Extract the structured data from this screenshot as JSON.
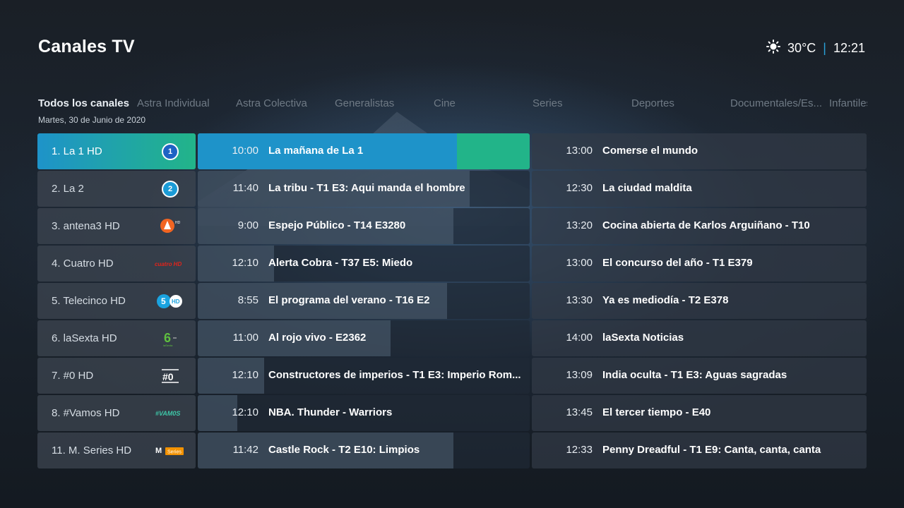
{
  "header": {
    "title": "Canales TV",
    "temperature": "30°C",
    "separator": "|",
    "clock": "12:21",
    "weather_icon": "sun-icon"
  },
  "tabs": [
    {
      "label": "Todos los canales",
      "active": true
    },
    {
      "label": "Astra Individual"
    },
    {
      "label": "Astra Colectiva"
    },
    {
      "label": "Generalistas"
    },
    {
      "label": "Cine"
    },
    {
      "label": "Series"
    },
    {
      "label": "Deportes"
    },
    {
      "label": "Documentales/Es..."
    },
    {
      "label": "Infantiles"
    }
  ],
  "date": "Martes, 30 de Junio de 2020",
  "channels": [
    {
      "name": "1. La 1 HD",
      "logo": "1",
      "now_time": "10:00",
      "now_title": "La mañana de La 1",
      "progress": 0.78,
      "next_time": "13:00",
      "next_title": "Comerse el mundo"
    },
    {
      "name": "2. La 2",
      "logo": "2",
      "now_time": "11:40",
      "now_title": "La tribu - T1 E3: Aqui manda el hombre",
      "progress": 0.82,
      "next_time": "12:30",
      "next_title": "La ciudad maldita"
    },
    {
      "name": "3. antena3 HD",
      "logo": "A3",
      "now_time": "9:00",
      "now_title": "Espejo Público - T14 E3280",
      "progress": 0.77,
      "next_time": "13:20",
      "next_title": "Cocina abierta de Karlos Arguiñano - T10"
    },
    {
      "name": "4. Cuatro HD",
      "logo": "cuatro",
      "now_time": "12:10",
      "now_title": "Alerta Cobra - T37 E5: Miedo",
      "progress": 0.23,
      "next_time": "13:00",
      "next_title": "El concurso del año - T1 E379"
    },
    {
      "name": "5. Telecinco HD",
      "logo": "5HD",
      "now_time": "8:55",
      "now_title": "El programa del verano - T16 E2",
      "progress": 0.75,
      "next_time": "13:30",
      "next_title": "Ya es mediodía - T2 E378"
    },
    {
      "name": "6. laSexta HD",
      "logo": "6",
      "now_time": "11:00",
      "now_title": "Al rojo vivo - E2362",
      "progress": 0.58,
      "next_time": "14:00",
      "next_title": "laSexta Noticias"
    },
    {
      "name": "7. #0 HD",
      "logo": "#0",
      "now_time": "12:10",
      "now_title": "Constructores de imperios - T1 E3: Imperio Rom...",
      "progress": 0.2,
      "next_time": "13:09",
      "next_title": "India oculta - T1 E3: Aguas sagradas"
    },
    {
      "name": "8. #Vamos HD",
      "logo": "#vamos",
      "now_time": "12:10",
      "now_title": "NBA. Thunder - Warriors",
      "progress": 0.12,
      "next_time": "13:45",
      "next_title": "El tercer tiempo - E40"
    },
    {
      "name": "11. M. Series HD",
      "logo": "M Series",
      "now_time": "11:42",
      "now_title": "Castle Rock - T2 E10: Limpios",
      "progress": 0.77,
      "next_time": "12:33",
      "next_title": "Penny Dreadful - T1 E9: Canta, canta, canta"
    }
  ]
}
